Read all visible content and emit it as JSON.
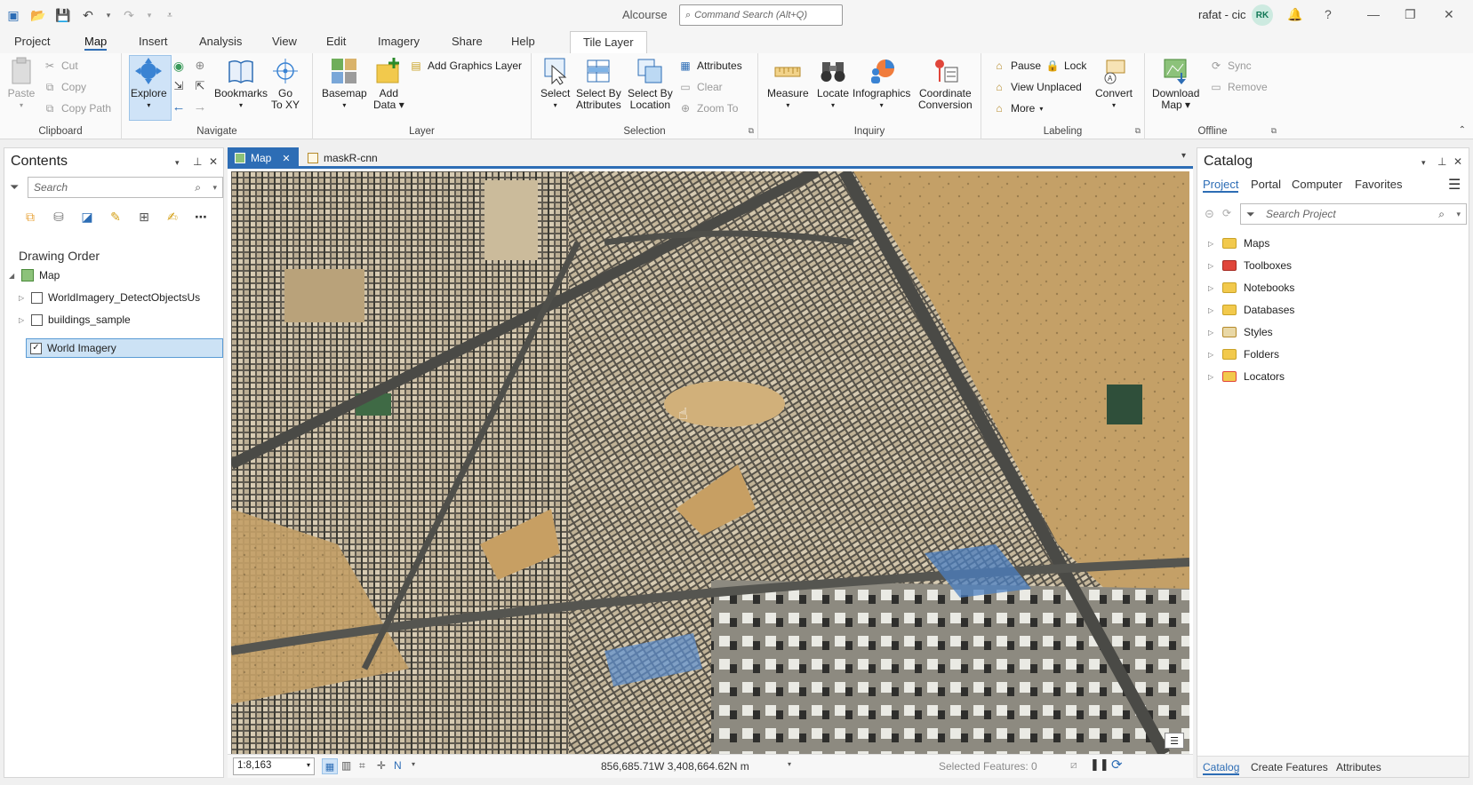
{
  "app": {
    "title": "Alcourse",
    "command_search_placeholder": "Command Search (Alt+Q)",
    "user": "rafat - cic",
    "initials": "RK"
  },
  "ribbon_tabs": [
    "Project",
    "Map",
    "Insert",
    "Analysis",
    "View",
    "Edit",
    "Imagery",
    "Share",
    "Help",
    "Tile Layer"
  ],
  "clipboard": {
    "paste": "Paste",
    "cut": "Cut",
    "copy": "Copy",
    "copy_path": "Copy Path",
    "label": "Clipboard"
  },
  "navigate": {
    "explore": "Explore",
    "bookmarks": "Bookmarks",
    "go_to_xy_1": "Go",
    "go_to_xy_2": "To XY",
    "label": "Navigate"
  },
  "layer": {
    "basemap": "Basemap",
    "add_data_1": "Add",
    "add_data_2": "Data",
    "add_graphics": "Add Graphics Layer",
    "label": "Layer"
  },
  "selection": {
    "select": "Select",
    "sba_1": "Select By",
    "sba_2": "Attributes",
    "sbl_1": "Select By",
    "sbl_2": "Location",
    "attributes": "Attributes",
    "clear": "Clear",
    "zoom_to": "Zoom To",
    "label": "Selection"
  },
  "inquiry": {
    "measure": "Measure",
    "locate": "Locate",
    "infographics": "Infographics",
    "coord_1": "Coordinate",
    "coord_2": "Conversion",
    "label": "Inquiry"
  },
  "labeling": {
    "pause": "Pause",
    "lock": "Lock",
    "view_unplaced": "View Unplaced",
    "more": "More",
    "convert": "Convert",
    "label": "Labeling"
  },
  "offline": {
    "download_1": "Download",
    "download_2": "Map",
    "sync": "Sync",
    "remove": "Remove",
    "label": "Offline"
  },
  "contents": {
    "title": "Contents",
    "search_placeholder": "Search",
    "drawing_order": "Drawing Order",
    "map_node": "Map",
    "layers": [
      {
        "name": "WorldImagery_DetectObjectsUs",
        "checked": false
      },
      {
        "name": "buildings_sample",
        "checked": false
      },
      {
        "name": "World Imagery",
        "checked": true
      }
    ]
  },
  "map_tabs": [
    "Map",
    "maskR-cnn"
  ],
  "map_status": {
    "scale": "1:8,163",
    "coordinates": "856,685.71W 3,408,664.62N m",
    "selected_features": "Selected Features: 0"
  },
  "catalog": {
    "title": "Catalog",
    "tabs": [
      "Project",
      "Portal",
      "Computer",
      "Favorites"
    ],
    "search_placeholder": "Search Project",
    "items": [
      "Maps",
      "Toolboxes",
      "Notebooks",
      "Databases",
      "Styles",
      "Folders",
      "Locators"
    ],
    "bottom_tabs": [
      "Catalog",
      "Create Features",
      "Attributes"
    ]
  },
  "colors": {
    "accent": "#2d6db5",
    "selection": "#cce2f5",
    "desert": "#c8a26a",
    "urban": "#6e6a5f"
  }
}
